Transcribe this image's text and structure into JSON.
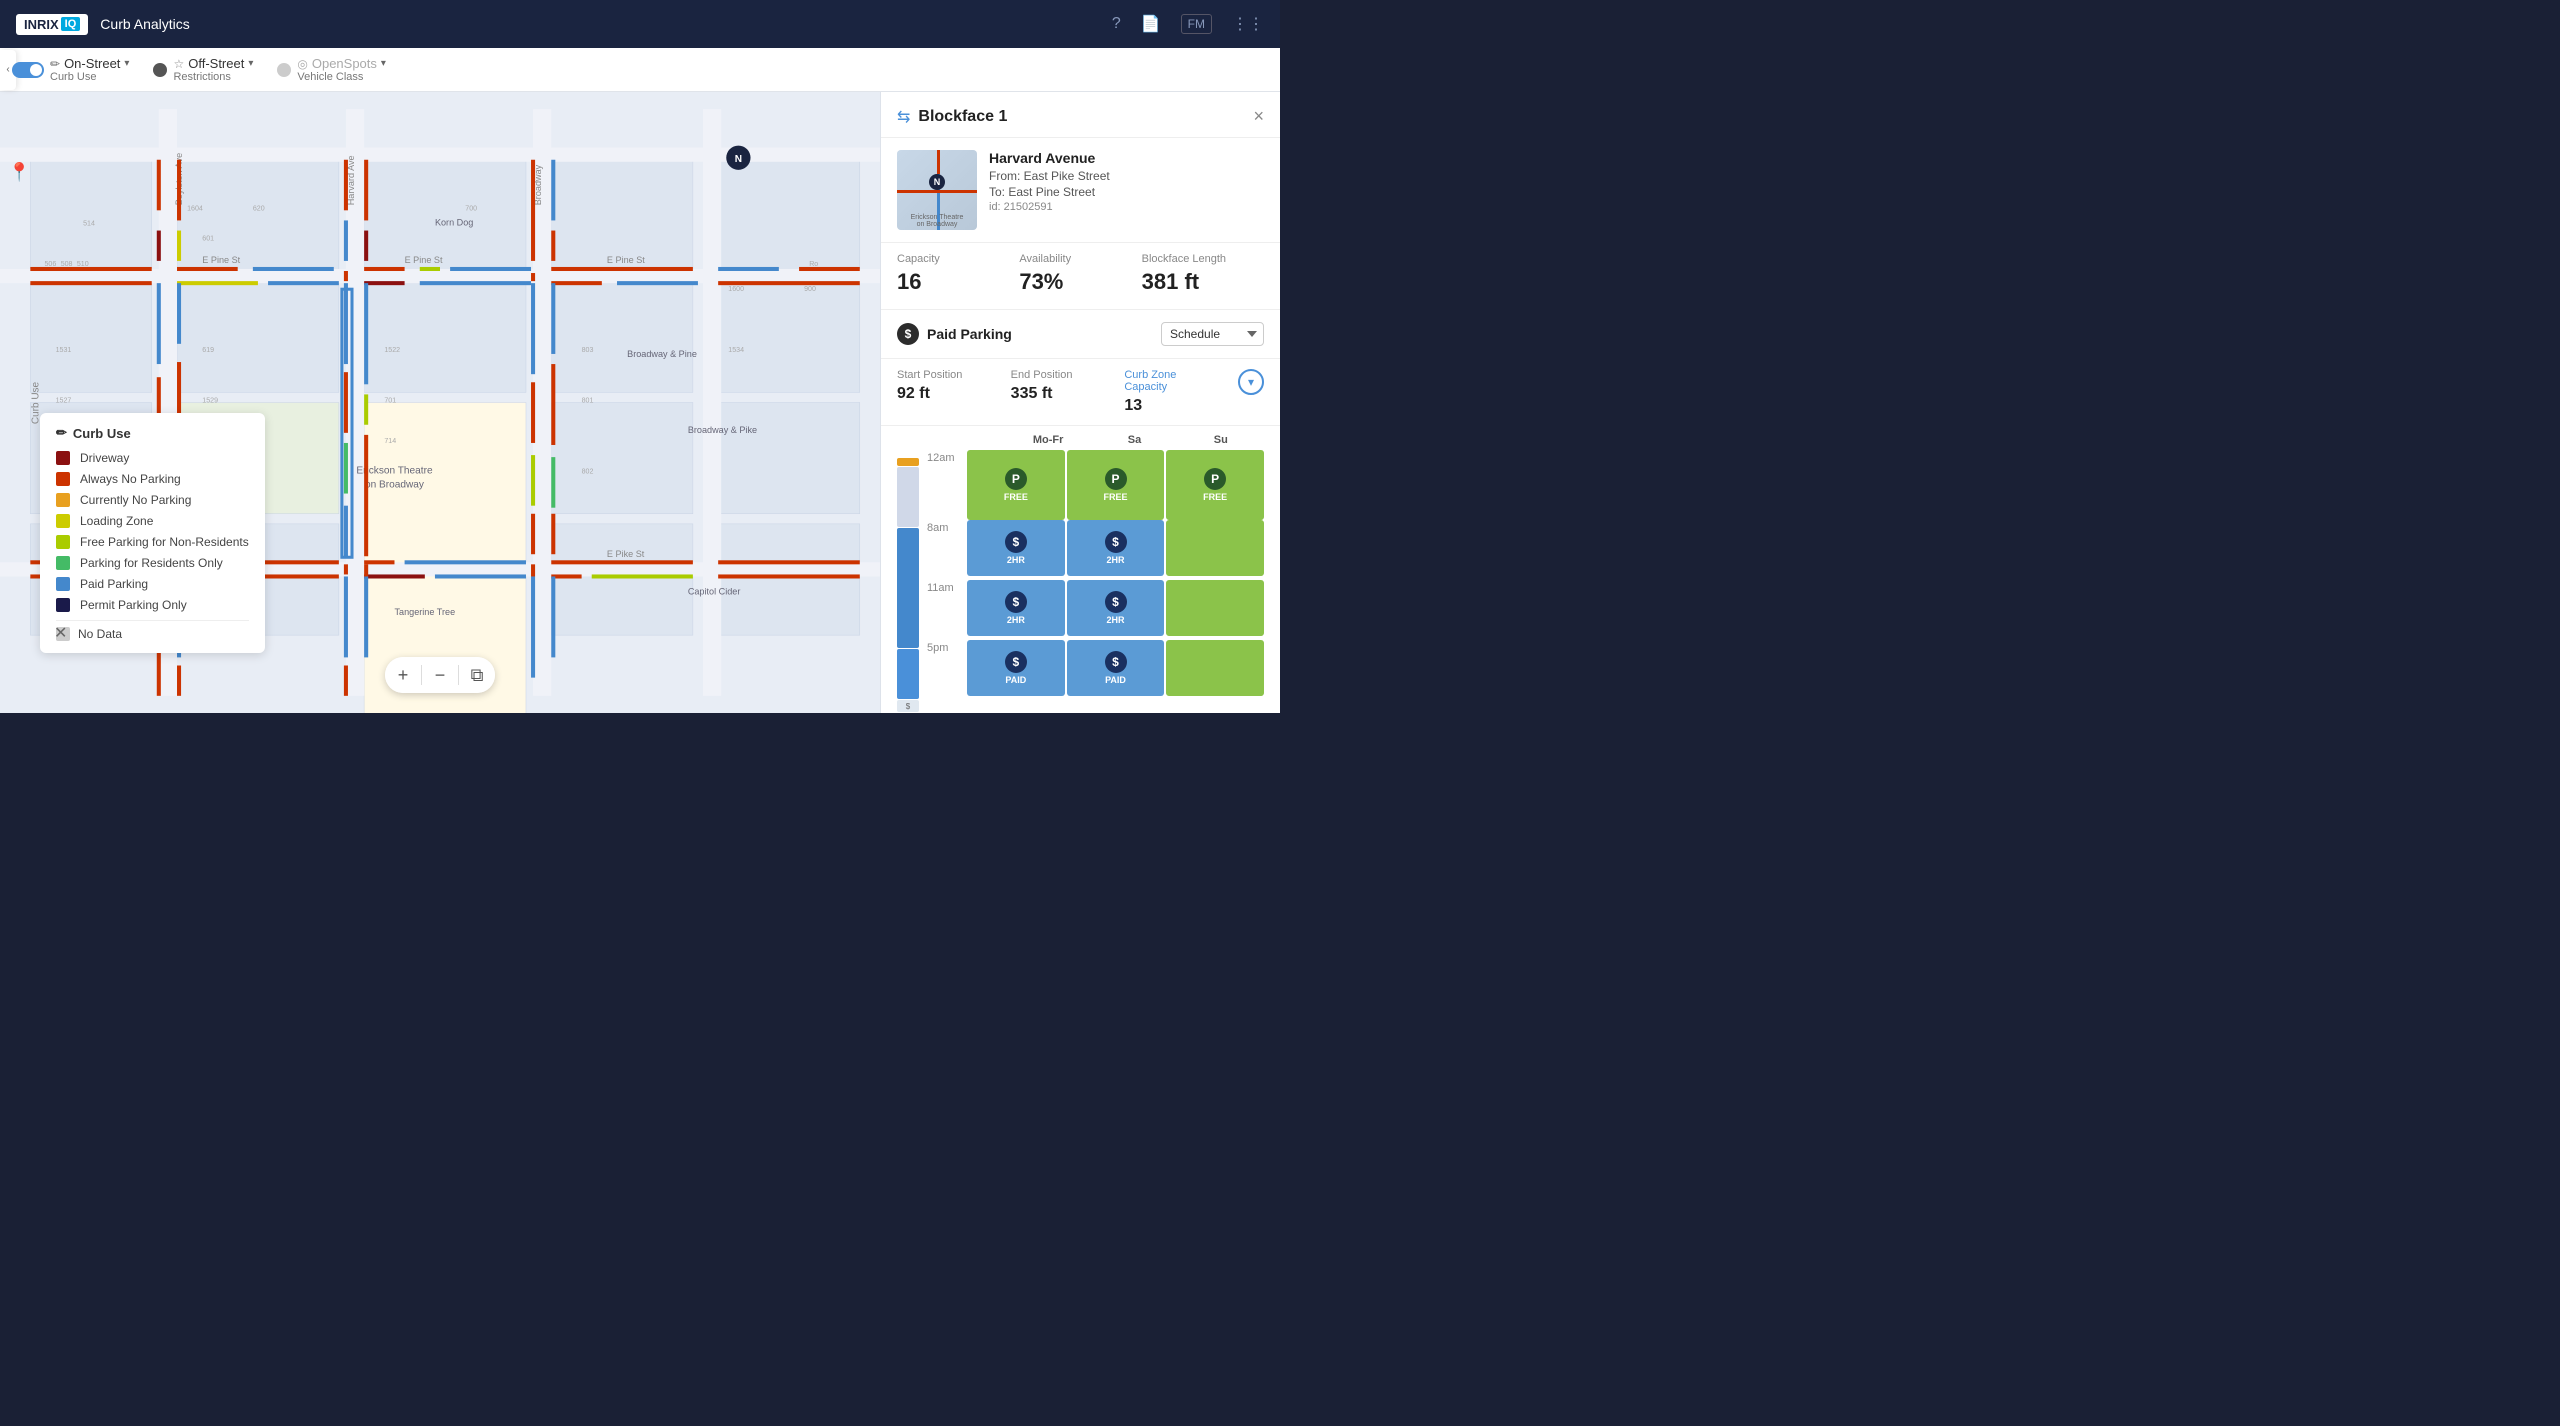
{
  "app": {
    "logo_text": "INRIX",
    "logo_iq": "IQ",
    "title": "Curb Analytics"
  },
  "header_icons": {
    "help": "?",
    "docs": "📄",
    "fm_label": "FM",
    "grid": "⋮⋮"
  },
  "toolbar": {
    "on_street_label": "On-Street",
    "on_street_sub": "Curb Use",
    "off_street_label": "Off-Street",
    "off_street_sub": "Restrictions",
    "open_spots_label": "OpenSpots",
    "open_spots_sub": "Vehicle Class"
  },
  "legend": {
    "title": "Curb Use",
    "items": [
      {
        "label": "Driveway",
        "color": "#8B1010"
      },
      {
        "label": "Always No Parking",
        "color": "#CC3300"
      },
      {
        "label": "Currently No Parking",
        "color": "#E8A020"
      },
      {
        "label": "Loading Zone",
        "color": "#CCCC00"
      },
      {
        "label": "Free Parking for Non-Residents",
        "color": "#AACC00"
      },
      {
        "label": "Parking for Residents Only",
        "color": "#44BB66"
      },
      {
        "label": "Paid Parking",
        "color": "#4488CC"
      },
      {
        "label": "Permit Parking Only",
        "color": "#1A1A4A"
      },
      {
        "label": "No Data",
        "color": "#CCCCCC"
      }
    ]
  },
  "panel": {
    "title": "Blockface 1",
    "close_label": "×",
    "street_name": "Harvard Avenue",
    "from": "From: East Pike Street",
    "to": "To: East Pine Street",
    "id": "id: 21502591",
    "stats": [
      {
        "label": "Capacity",
        "value": "16"
      },
      {
        "label": "Availability",
        "value": "73%"
      },
      {
        "label": "Blockface Length",
        "value": "381 ft"
      }
    ],
    "paid_parking_label": "Paid Parking",
    "schedule_label": "Schedule",
    "zone_details": {
      "start_label": "Start Position",
      "start_value": "92 ft",
      "end_label": "End Position",
      "end_value": "335 ft",
      "capacity_label": "Curb Zone Capacity",
      "capacity_value": "13"
    },
    "schedule": {
      "day_headers": [
        "Mo-Fr",
        "Sa",
        "Su"
      ],
      "time_rows": [
        {
          "time": "12am",
          "cells": [
            {
              "type": "green",
              "icon": "P",
              "icon_type": "p-dark",
              "label": "FREE"
            },
            {
              "type": "green",
              "icon": "P",
              "icon_type": "p-dark",
              "label": "FREE"
            },
            {
              "type": "green",
              "icon": "P",
              "icon_type": "p-dark",
              "label": "FREE"
            }
          ]
        },
        {
          "time": "8am",
          "cells": [
            {
              "type": "blue",
              "icon": "$",
              "icon_type": "dollar-dark",
              "label": "2HR"
            },
            {
              "type": "blue",
              "icon": "$",
              "icon_type": "dollar-dark",
              "label": "2HR"
            },
            {
              "type": "green",
              "icon": "",
              "icon_type": "",
              "label": ""
            }
          ]
        },
        {
          "time": "11am",
          "cells": [
            {
              "type": "blue",
              "icon": "$",
              "icon_type": "dollar-dark",
              "label": "2HR"
            },
            {
              "type": "blue",
              "icon": "$",
              "icon_type": "dollar-dark",
              "label": "2HR"
            },
            {
              "type": "green",
              "icon": "",
              "icon_type": "",
              "label": ""
            }
          ]
        },
        {
          "time": "5pm",
          "cells": [
            {
              "type": "blue",
              "icon": "$",
              "icon_type": "dollar-dark",
              "label": "PAID"
            },
            {
              "type": "blue",
              "icon": "$",
              "icon_type": "dollar-dark",
              "label": "PAID"
            },
            {
              "type": "green",
              "icon": "",
              "icon_type": "",
              "label": ""
            }
          ]
        }
      ]
    }
  },
  "map_controls": {
    "zoom_in": "+",
    "zoom_out": "−",
    "layers": "⧉"
  }
}
